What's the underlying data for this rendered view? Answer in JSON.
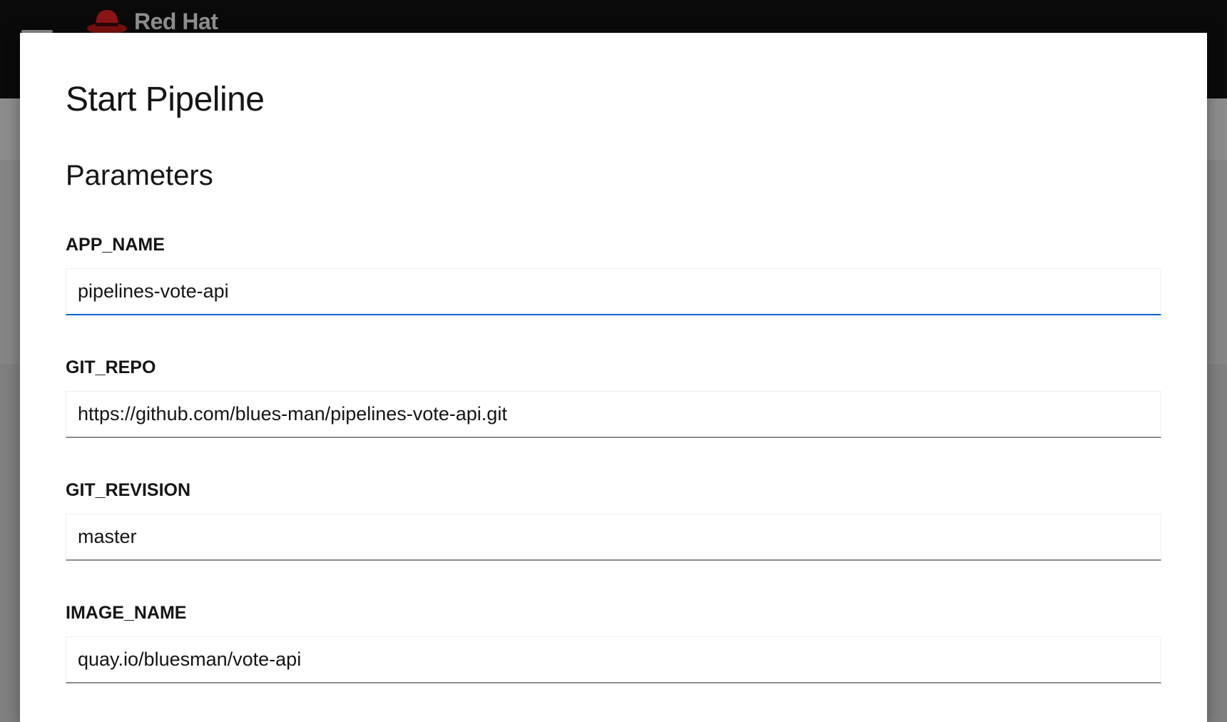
{
  "masthead": {
    "brand": "Red Hat",
    "menu_icon": "hamburger-icon",
    "logo_icon": "redhat-fedora-icon"
  },
  "modal": {
    "title": "Start Pipeline",
    "section_title": "Parameters",
    "fields": [
      {
        "label": "APP_NAME",
        "value": "pipelines-vote-api",
        "focused": true
      },
      {
        "label": "GIT_REPO",
        "value": "https://github.com/blues-man/pipelines-vote-api.git",
        "focused": false
      },
      {
        "label": "GIT_REVISION",
        "value": "master",
        "focused": false
      },
      {
        "label": "IMAGE_NAME",
        "value": "quay.io/bluesman/vote-api",
        "focused": false
      }
    ]
  },
  "colors": {
    "focus_accent": "#0066cc",
    "brand_red": "#ee0000",
    "masthead_bg": "#0a0a0a"
  }
}
